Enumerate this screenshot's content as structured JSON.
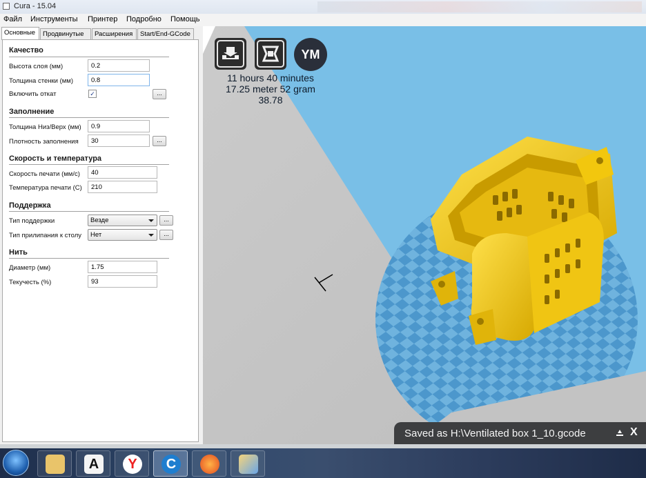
{
  "window": {
    "title": "Cura - 15.04"
  },
  "menu": [
    "Файл",
    "Инструменты",
    "Принтер",
    "Подробно",
    "Помощь"
  ],
  "tabs": [
    "Основные",
    "Продвинутые",
    "Расширения",
    "Start/End-GCode"
  ],
  "active_tab": "Основные",
  "sections": {
    "quality": {
      "title": "Качество",
      "layer_height_label": "Высота слоя (мм)",
      "layer_height": "0.2",
      "shell_thickness_label": "Толщина стенки (мм)",
      "shell_thickness": "0.8",
      "retraction_label": "Включить откат",
      "retraction_checked": true
    },
    "fill": {
      "title": "Заполнение",
      "bottom_top_label": "Толщина Низ/Верх (мм)",
      "bottom_top": "0.9",
      "density_label": "Плотность заполнения",
      "density": "30"
    },
    "speed": {
      "title": "Скорость и температура",
      "print_speed_label": "Скорость печати (мм/с)",
      "print_speed": "40",
      "temp_label": "Температура печати (C)",
      "temp": "210"
    },
    "support": {
      "title": "Поддержка",
      "type_label": "Тип поддержки",
      "type_value": "Везде",
      "adhesion_label": "Тип прилипания к столу",
      "adhesion_value": "Нет"
    },
    "filament": {
      "title": "Нить",
      "diameter_label": "Диаметр (мм)",
      "diameter": "1.75",
      "flow_label": "Текучесть (%)",
      "flow": "93"
    }
  },
  "dots_label": "...",
  "viewport": {
    "time": "11 hours 40 minutes",
    "material": "17.25 meter 52 gram",
    "cost": "38.78",
    "ym_button": "YM",
    "saved_message": "Saved as H:\\Ventilated box 1_10.gcode",
    "close_label": "X",
    "colors": {
      "model": "#f2c70e",
      "bed": "#6fb3de",
      "bed_dark": "#4c97cc",
      "floor": "#c3c3c3"
    }
  },
  "taskbar": {
    "apps": [
      "start-orb",
      "file-explorer-icon",
      "font-viewer-icon",
      "yandex-browser-icon",
      "cura-icon",
      "firefox-icon",
      "paint-icon"
    ],
    "active": "cura-icon"
  }
}
